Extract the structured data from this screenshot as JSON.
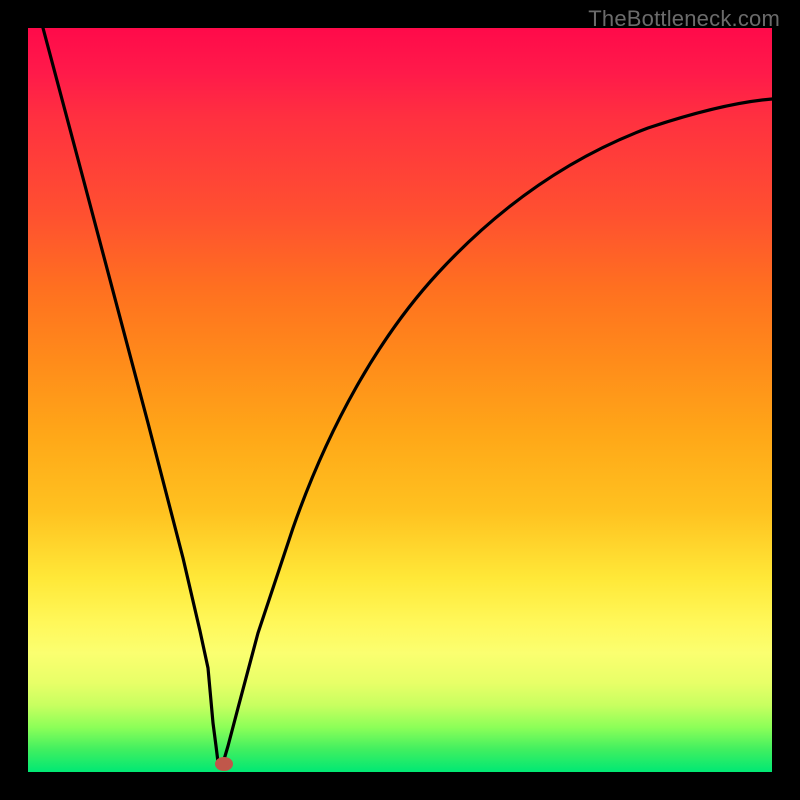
{
  "watermark": "TheBottleneck.com",
  "colors": {
    "frame": "#000000",
    "stroke": "#000000",
    "marker": "#c0574a",
    "gradient_top": "#ff0a4a",
    "gradient_bottom": "#00e874"
  },
  "chart_data": {
    "type": "line",
    "title": "",
    "xlabel": "",
    "ylabel": "",
    "xlim": [
      0,
      100
    ],
    "ylim": [
      0,
      100
    ],
    "series": [
      {
        "name": "bottleneck-curve",
        "x": [
          2,
          5,
          10,
          15,
          18,
          20,
          22,
          23,
          24,
          25,
          27,
          30,
          35,
          40,
          45,
          50,
          55,
          60,
          65,
          70,
          75,
          80,
          85,
          90,
          95,
          100
        ],
        "y": [
          100,
          88,
          68,
          48,
          36,
          26,
          14,
          6,
          1,
          0.5,
          8,
          22,
          40,
          52,
          61,
          68,
          73,
          77,
          80,
          82.5,
          84.5,
          86,
          87.2,
          88.2,
          89,
          89.6
        ]
      }
    ],
    "annotations": [
      {
        "name": "optimal-point",
        "x": 25,
        "y": 0.5
      }
    ]
  }
}
